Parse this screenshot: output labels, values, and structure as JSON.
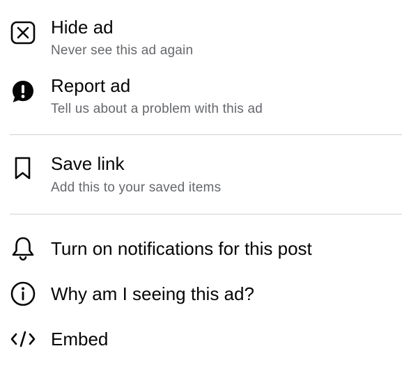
{
  "menu": {
    "hide_ad": {
      "title": "Hide ad",
      "subtitle": "Never see this ad again",
      "icon": "close-box-icon"
    },
    "report_ad": {
      "title": "Report ad",
      "subtitle": "Tell us about a problem with this ad",
      "icon": "report-alert-icon"
    },
    "save_link": {
      "title": "Save link",
      "subtitle": "Add this to your saved items",
      "icon": "bookmark-icon"
    },
    "notifications": {
      "title": "Turn on notifications for this post",
      "icon": "bell-icon"
    },
    "why_ad": {
      "title": "Why am I seeing this ad?",
      "icon": "info-icon"
    },
    "embed": {
      "title": "Embed",
      "icon": "code-icon"
    }
  },
  "colors": {
    "title_text": "#050505",
    "subtitle_text": "#65676b",
    "divider": "#ced0d4",
    "icon": "#050505"
  }
}
